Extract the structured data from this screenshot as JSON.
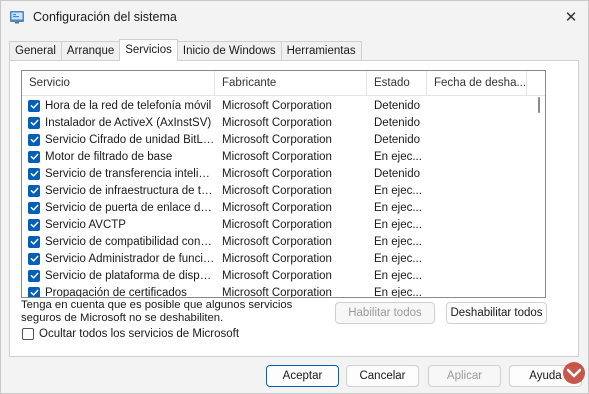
{
  "window": {
    "title": "Configuración del sistema",
    "close_glyph": "✕"
  },
  "tabs": [
    {
      "label": "General",
      "active": false
    },
    {
      "label": "Arranque",
      "active": false
    },
    {
      "label": "Servicios",
      "active": true
    },
    {
      "label": "Inicio de Windows",
      "active": false
    },
    {
      "label": "Herramientas",
      "active": false
    }
  ],
  "list": {
    "columns": [
      "Servicio",
      "Fabricante",
      "Estado",
      "Fecha de desha..."
    ],
    "rows": [
      {
        "service": "Hora de la red de telefonía móvil",
        "maker": "Microsoft Corporation",
        "state": "Detenido",
        "date": "",
        "checked": true
      },
      {
        "service": "Instalador de ActiveX (AxInstSV)",
        "maker": "Microsoft Corporation",
        "state": "Detenido",
        "date": "",
        "checked": true
      },
      {
        "service": "Servicio Cifrado de unidad BitLoc...",
        "maker": "Microsoft Corporation",
        "state": "Detenido",
        "date": "",
        "checked": true
      },
      {
        "service": "Motor de filtrado de base",
        "maker": "Microsoft Corporation",
        "state": "En ejec...",
        "date": "",
        "checked": true
      },
      {
        "service": "Servicio de transferencia intelige...",
        "maker": "Microsoft Corporation",
        "state": "Detenido",
        "date": "",
        "checked": true
      },
      {
        "service": "Servicio de infraestructura de ta...",
        "maker": "Microsoft Corporation",
        "state": "En ejec...",
        "date": "",
        "checked": true
      },
      {
        "service": "Servicio de puerta de enlace de ...",
        "maker": "Microsoft Corporation",
        "state": "En ejec...",
        "date": "",
        "checked": true
      },
      {
        "service": "Servicio AVCTP",
        "maker": "Microsoft Corporation",
        "state": "En ejec...",
        "date": "",
        "checked": true
      },
      {
        "service": "Servicio de compatibilidad con Bl...",
        "maker": "Microsoft Corporation",
        "state": "En ejec...",
        "date": "",
        "checked": true
      },
      {
        "service": "Servicio Administrador de funcio...",
        "maker": "Microsoft Corporation",
        "state": "En ejec...",
        "date": "",
        "checked": true
      },
      {
        "service": "Servicio de plataforma de dispos...",
        "maker": "Microsoft Corporation",
        "state": "En ejec...",
        "date": "",
        "checked": true
      },
      {
        "service": "Propagación de certificados",
        "maker": "Microsoft Corporation",
        "state": "En ejec...",
        "date": "",
        "checked": true
      }
    ]
  },
  "note": {
    "line1": "Tenga en cuenta que es posible que algunos servicios",
    "line2": "seguros de Microsoft no se deshabiliten."
  },
  "buttons": {
    "enable_all": "Habilitar todos",
    "disable_all": "Deshabilitar todos",
    "ok": "Aceptar",
    "cancel": "Cancelar",
    "apply": "Aplicar",
    "help": "Ayuda"
  },
  "hide_ms": {
    "label": "Ocultar todos los servicios de Microsoft",
    "checked": false
  },
  "colors": {
    "accent": "#005fb8",
    "window_bg": "#f3f3f3",
    "watermark": "#c0392b"
  }
}
